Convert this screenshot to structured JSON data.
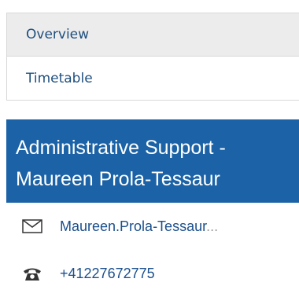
{
  "nav": {
    "items": [
      {
        "label": "Overview"
      },
      {
        "label": "Timetable"
      }
    ]
  },
  "contact": {
    "title_line1": "Administrative Support -",
    "title_line2": "Maureen Prola-Tessaur",
    "email_text": "Maureen.Prola-Tessaur",
    "email_ellipsis": "...",
    "phone": "+41227672775",
    "email_icon": "envelope-icon",
    "phone_icon": "telephone-icon"
  }
}
